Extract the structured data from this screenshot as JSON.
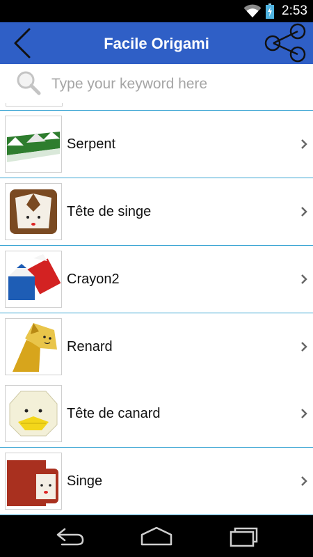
{
  "status_bar": {
    "time": "2:53",
    "icons": [
      "wifi-icon",
      "battery-charging-icon"
    ]
  },
  "app_bar": {
    "title": "Facile Origami",
    "color": "#2f5fc6",
    "back_icon": "chevron-left-icon",
    "share_icon": "share-icon"
  },
  "search": {
    "placeholder": "Type your keyword here",
    "value": "",
    "icon": "search-icon"
  },
  "list": {
    "divider_color": "#3aa5d3",
    "items": [
      {
        "label": "Serpent",
        "icon": "chevron-right-icon"
      },
      {
        "label": "Tête de singe",
        "icon": "chevron-right-icon"
      },
      {
        "label": "Crayon2",
        "icon": "chevron-right-icon"
      },
      {
        "label": "Renard",
        "icon": "chevron-right-icon"
      },
      {
        "label": "Tête de canard",
        "icon": "chevron-right-icon"
      },
      {
        "label": "Singe",
        "icon": "chevron-right-icon"
      }
    ]
  },
  "nav_bar": {
    "buttons": [
      "back-icon",
      "home-icon",
      "recent-apps-icon"
    ]
  }
}
